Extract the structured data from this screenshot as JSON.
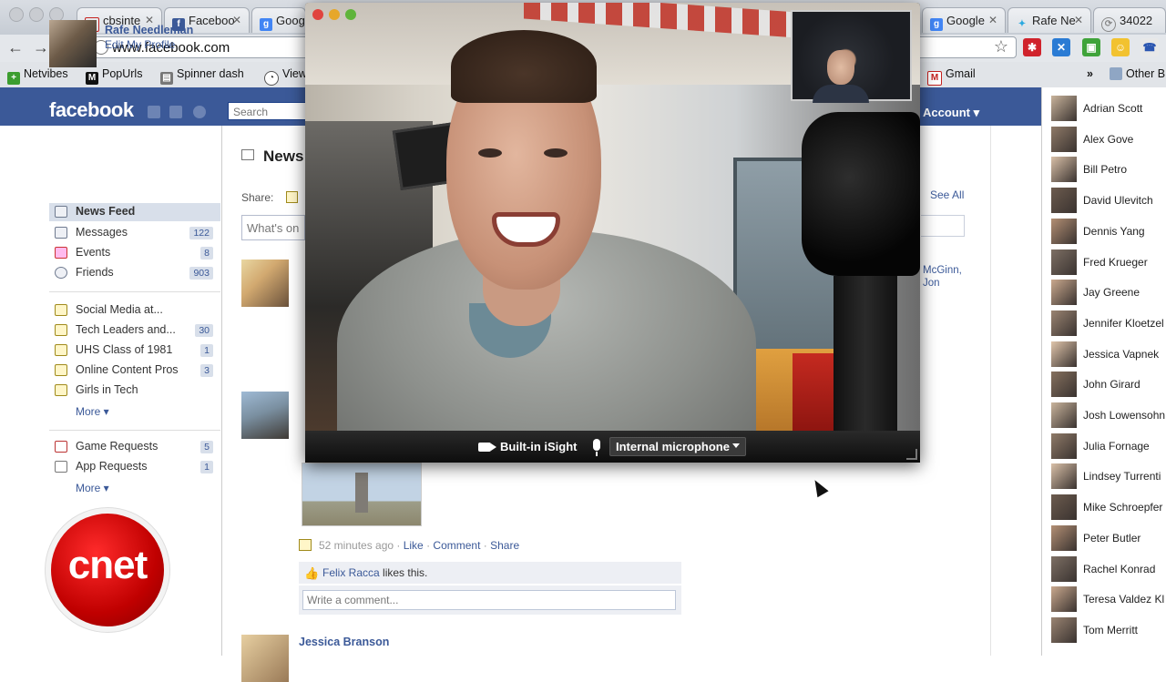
{
  "browser": {
    "tabs": [
      {
        "label": "cbsinte",
        "icon": "gmail-icon",
        "color": "#c5221f"
      },
      {
        "label": "Faceboo",
        "icon": "facebook-icon",
        "color": "#3b5998"
      },
      {
        "label": "Google",
        "icon": "google-icon",
        "color": "#4285f4"
      },
      {
        "label": "Google",
        "icon": "google-icon",
        "color": "#4285f4"
      },
      {
        "label": "Rafe Ne",
        "icon": "twitter-icon",
        "color": "#2aa9e0"
      },
      {
        "label": "34022",
        "icon": "page-icon",
        "color": "#888888"
      }
    ],
    "url": "www.facebook.com",
    "bookmarks": {
      "netvibes": "Netvibes",
      "popurls": "PopUrls",
      "spinner": "Spinner dash",
      "view": "View",
      "gmail": "Gmail",
      "other": "Other B",
      "overflow": "»"
    }
  },
  "facebook": {
    "logo": "facebook",
    "search_placeholder": "Search",
    "account": "Account ▾",
    "profile": {
      "name": "Rafe Needleman",
      "edit": "Edit My Profile"
    },
    "nav": [
      {
        "label": "News Feed",
        "count": "",
        "selected": true
      },
      {
        "label": "Messages",
        "count": "122"
      },
      {
        "label": "Events",
        "count": "8"
      },
      {
        "label": "Friends",
        "count": "903"
      }
    ],
    "groups": [
      {
        "label": "Social Media at...",
        "count": ""
      },
      {
        "label": "Tech Leaders and...",
        "count": "30"
      },
      {
        "label": "UHS Class of 1981",
        "count": "1"
      },
      {
        "label": "Online Content Pros",
        "count": "3"
      },
      {
        "label": "Girls in Tech",
        "count": ""
      }
    ],
    "more1": "More ▾",
    "apps": [
      {
        "label": "Game Requests",
        "count": "5"
      },
      {
        "label": "App Requests",
        "count": "1"
      }
    ],
    "more2": "More ▾",
    "feed": {
      "title": "News",
      "share_label": "Share:",
      "status_placeholder": "What's on",
      "see_all": "See All",
      "mention": "McGinn,\nJon",
      "post_meta_time": "52 minutes ago · ",
      "post_meta_like": "Like",
      "post_meta_sep1": " · ",
      "post_meta_comment": "Comment",
      "post_meta_sep2": " · ",
      "post_meta_share": "Share",
      "likes_name": "Felix Racca",
      "likes_text": " likes this.",
      "comment_placeholder": "Write a comment...",
      "next_author": "Jessica Branson"
    },
    "friends": [
      "Adrian Scott",
      "Alex Gove",
      "Bill Petro",
      "David Ulevitch",
      "Dennis Yang",
      "Fred Krueger",
      "Jay Greene",
      "Jennifer Kloetzel",
      "Jessica Vapnek",
      "John Girard",
      "Josh Lowensohn",
      "Julia Fornage",
      "Lindsey Turrenti",
      "Mike Schroepfer",
      "Peter Butler",
      "Rachel Konrad",
      "Teresa Valdez Kl",
      "Tom Merritt"
    ]
  },
  "video_chat": {
    "camera_label": "Built-in iSight",
    "mic_label": "Internal microphone"
  },
  "watermark": "cnet"
}
